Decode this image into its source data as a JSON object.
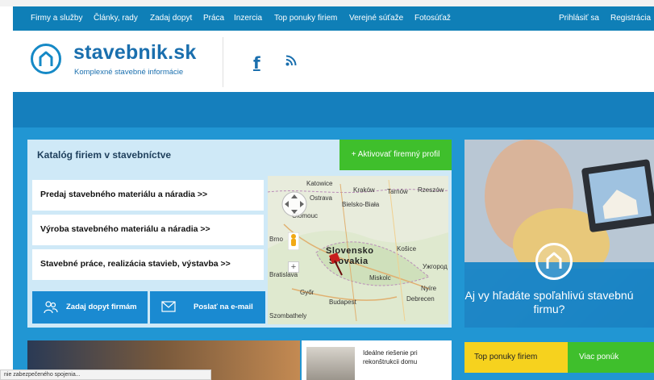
{
  "nav": {
    "items": [
      "Firmy a služby",
      "Články, rady",
      "Zadaj dopyt",
      "Práca",
      "Inzercia",
      "Top ponuky firiem",
      "Verejné súťaže",
      "Fotosúťaž"
    ],
    "login": "Prihlásiť sa",
    "register": "Registrácia"
  },
  "header": {
    "logo_name": "stavebnik.sk",
    "tagline": "Komplexné stavebné informácie",
    "icons": [
      "home-logo-icon",
      "facebook-icon",
      "rss-icon"
    ]
  },
  "catalog": {
    "title": "Katalóg firiem v stavebníctve",
    "activate_label": "+ Aktivovať firemný profil",
    "items": [
      "Predaj stavebného materiálu a náradia >>",
      "Výroba stavebného materiálu a náradia >>",
      "Stavebné práce, realizácia stavieb, výstavba >>"
    ],
    "demand_button": "Zadaj dopyt firmám",
    "email_button": "Poslať na e-mail"
  },
  "map": {
    "labels": [
      "Katowice",
      "Kraków",
      "Tarnów",
      "Rzeszów",
      "Ostrava",
      "Bielsko-Biała",
      "Olomouc",
      "Brno",
      "Slovensko",
      "Košice",
      "Slovakia",
      "Bratislava",
      "Miskolc",
      "Ужгород",
      "Győr",
      "Budapest",
      "Debrecen",
      "Nyíre",
      "Szombathely"
    ]
  },
  "promo": {
    "text": "Aj vy hľadáte spoľahlivú stavebnú firmu?"
  },
  "article": {
    "text": "Ideálne riešenie pri rekonštrukcii domu"
  },
  "tabs": {
    "top_offers": "Top ponuky firiem",
    "more_offers": "Viac ponúk"
  },
  "status": {
    "text": "nie zabezpečeného spojenia..."
  },
  "colors": {
    "nav": "#0f7fb7",
    "brand": "#1a6fae",
    "main": "#2196d3",
    "green": "#3fbf2c",
    "yellow": "#f6d21e"
  }
}
